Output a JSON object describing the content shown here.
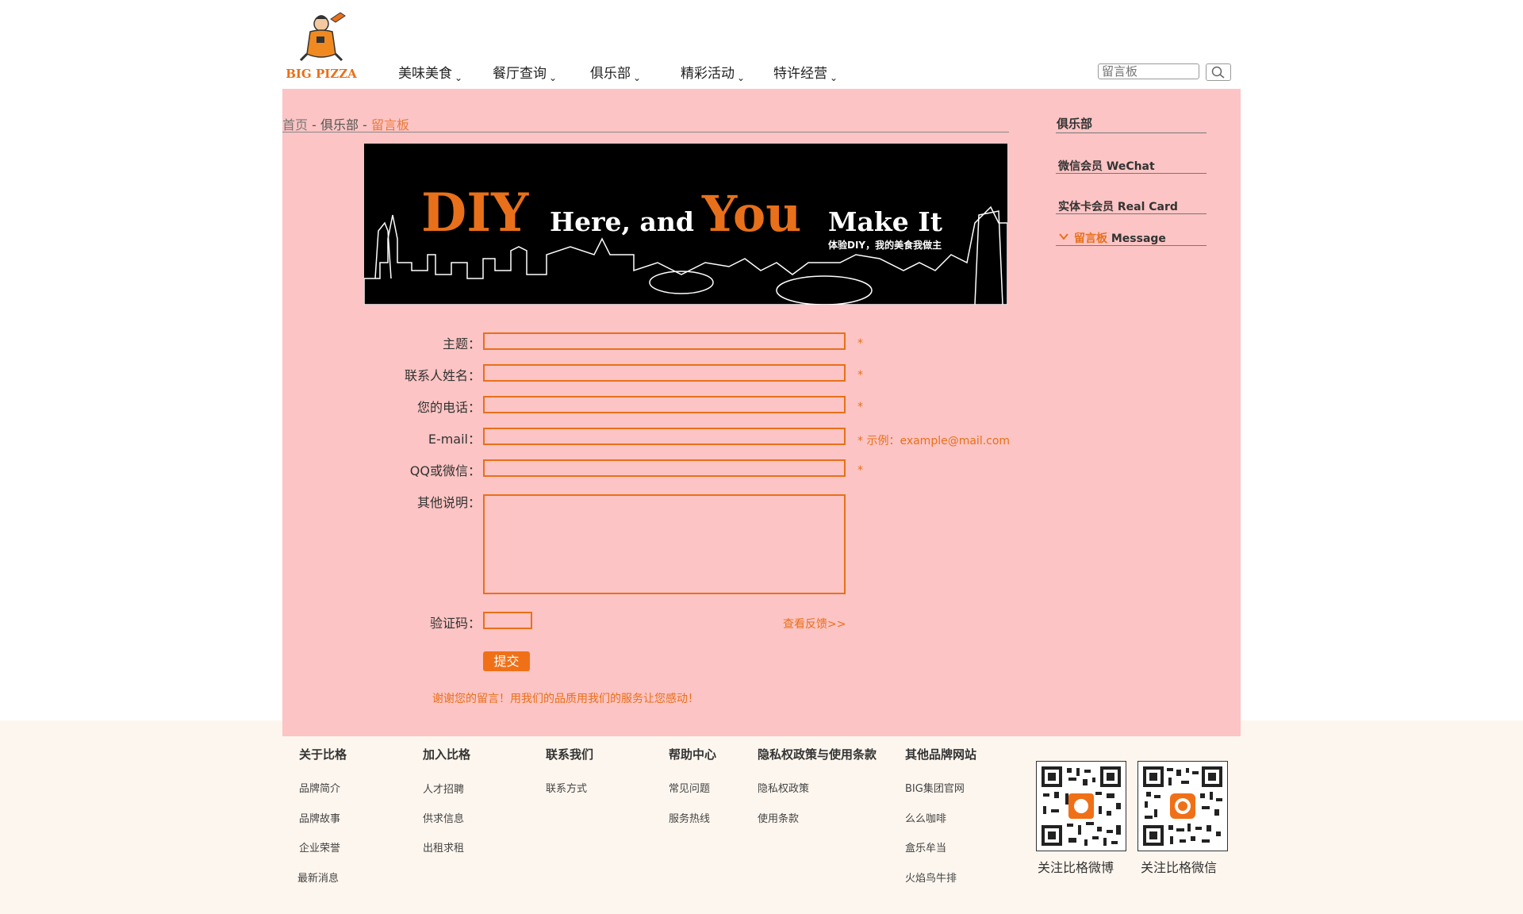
{
  "brand": {
    "logo_text": "BIG PIZZA"
  },
  "nav": {
    "items": [
      {
        "label": "美味美食"
      },
      {
        "label": "餐厅查询"
      },
      {
        "label": "俱乐部"
      },
      {
        "label": "精彩活动"
      },
      {
        "label": "特许经营"
      }
    ],
    "caret": "⌄"
  },
  "search": {
    "placeholder": "留言板"
  },
  "breadcrumb": {
    "home": "首页",
    "sep": " - ",
    "section": "俱乐部",
    "current": "留言板"
  },
  "banner": {
    "big1": "DIY",
    "text1": "Here, and",
    "big2": "You",
    "text2": "Make It",
    "subtitle": "体验DIY，我的美食我做主"
  },
  "form": {
    "subject_label": "主题：",
    "name_label": "联系人姓名：",
    "phone_label": "您的电话：",
    "email_label": "E-mail：",
    "qq_label": "QQ或微信：",
    "other_label": "其他说明：",
    "captcha_label": "验证码：",
    "required_mark": "*",
    "email_hint": "* 示例：example@mail.com",
    "feedback_link": "查看反馈>>",
    "submit_label": "提交",
    "thanks": "谢谢您的留言！用我们的品质用我们的服务让您感动！"
  },
  "sidebar": {
    "title": "俱乐部",
    "items": [
      {
        "cn": "微信会员",
        "en": "WeChat"
      },
      {
        "cn": "实体卡会员",
        "en": "Real Card"
      },
      {
        "cn": "留言板",
        "en": "Message"
      }
    ]
  },
  "footer": {
    "columns": [
      {
        "title": "关于比格",
        "links": [
          "品牌简介",
          "品牌故事",
          "企业荣誉",
          "最新消息"
        ]
      },
      {
        "title": "加入比格",
        "links": [
          "人才招聘",
          "供求信息",
          "出租求租"
        ]
      },
      {
        "title": "联系我们",
        "links": [
          "联系方式"
        ]
      },
      {
        "title": "帮助中心",
        "links": [
          "常见问题",
          "服务热线"
        ]
      },
      {
        "title": "隐私权政策与使用条款",
        "links": [
          "隐私权政策",
          "使用条款"
        ]
      },
      {
        "title": "其他品牌网站",
        "links": [
          "BIG集团官网",
          "么么咖啡",
          "盒乐牟当",
          "火焰鸟牛排"
        ]
      }
    ],
    "qr": [
      {
        "caption": "关注比格微博"
      },
      {
        "caption": "关注比格微信"
      }
    ]
  },
  "colors": {
    "accent": "#e8701a",
    "pink_bg": "#fcc4c4",
    "footer_bg": "#fdf6ee"
  },
  "icons": {
    "search": "search-icon",
    "active": "chevron-down-icon"
  }
}
